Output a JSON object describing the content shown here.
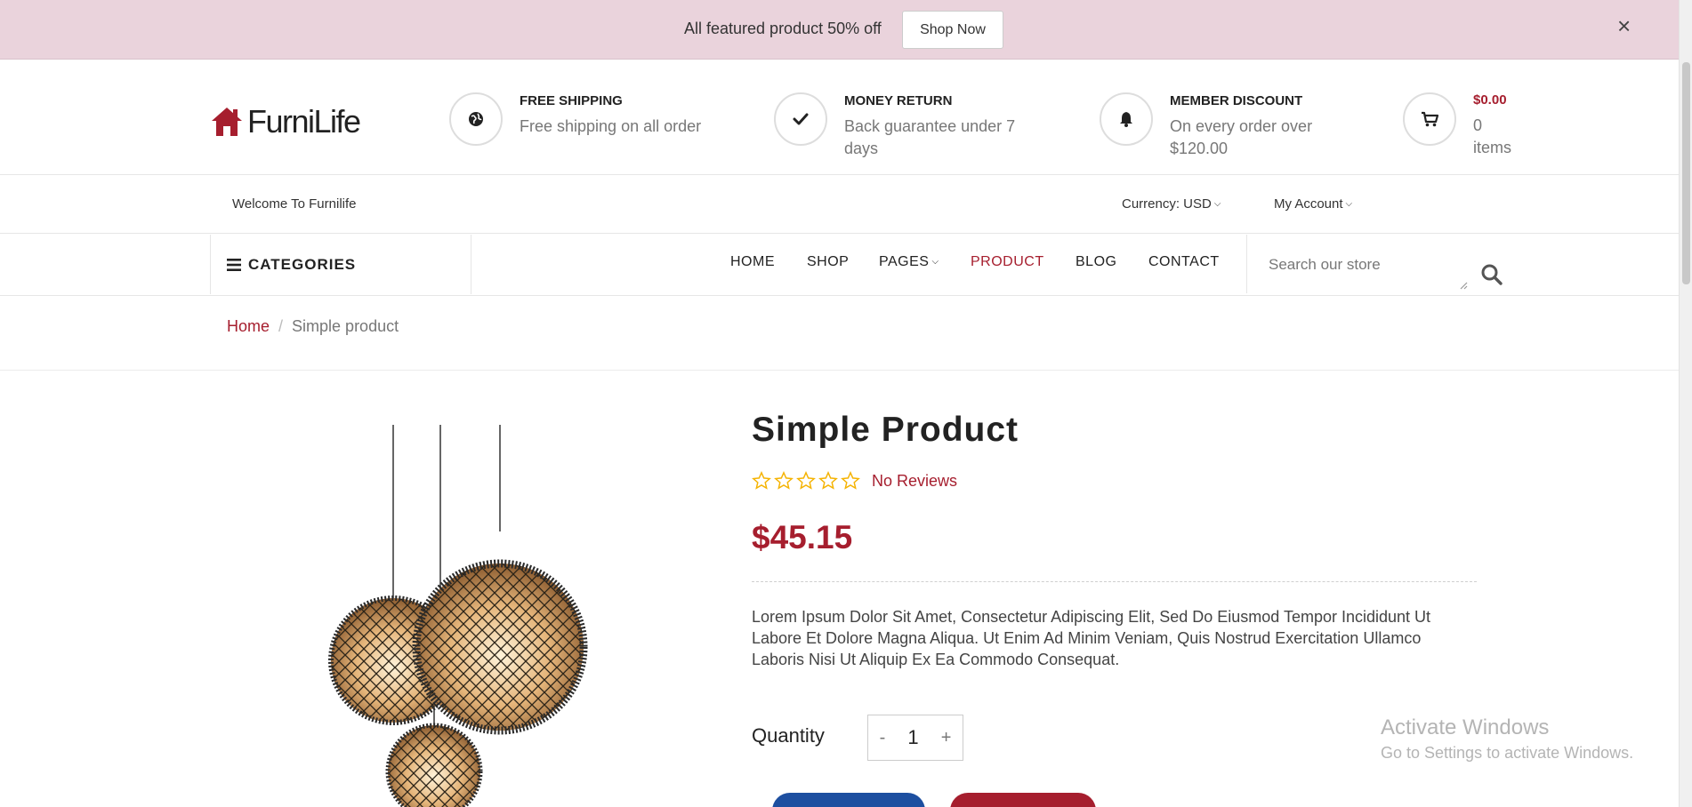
{
  "announcement": {
    "text": "All featured product 50% off",
    "button_label": "Shop Now",
    "close_glyph": "×"
  },
  "brand": {
    "name": "FurniLife",
    "accent": "#a61e2e"
  },
  "features": [
    {
      "icon": "globe-icon",
      "title": "FREE SHIPPING",
      "desc": "Free shipping on all order"
    },
    {
      "icon": "check-icon",
      "title": "MONEY RETURN",
      "desc": "Back guarantee under 7 days"
    },
    {
      "icon": "bell-icon",
      "title": "MEMBER DISCOUNT",
      "desc": "On every order over $120.00"
    }
  ],
  "cart": {
    "total": "$0.00",
    "count": "0",
    "items_label": "items"
  },
  "topnav": {
    "welcome": "Welcome To Furnilife",
    "currency": "Currency: USD",
    "account": "My Account"
  },
  "menu": {
    "categories_label": "CATEGORIES",
    "items": [
      {
        "label": "HOME"
      },
      {
        "label": "SHOP"
      },
      {
        "label": "PAGES"
      },
      {
        "label": "PRODUCT"
      },
      {
        "label": "BLOG"
      },
      {
        "label": "CONTACT"
      }
    ],
    "active": "PRODUCT",
    "search_placeholder": "Search our store"
  },
  "breadcrumb": {
    "home": "Home",
    "separator": "/",
    "current": "Simple product"
  },
  "product": {
    "title": "Simple Product",
    "rating": 0,
    "rating_max": 5,
    "reviews": "No Reviews",
    "price": "$45.15",
    "description": "Lorem Ipsum Dolor Sit Amet, Consectetur Adipiscing Elit, Sed Do Eiusmod Tempor Incididunt Ut Labore Et Dolore Magna Aliqua. Ut Enim Ad Minim Veniam, Quis Nostrud Exercitation Ullamco Laboris Nisi Ut Aliquip Ex Ea Commodo Consequat.",
    "quantity_label": "Quantity",
    "quantity": "1",
    "minus": "-",
    "plus": "+"
  },
  "watermark": {
    "title": "Activate Windows",
    "subtitle": "Go to Settings to activate Windows."
  }
}
